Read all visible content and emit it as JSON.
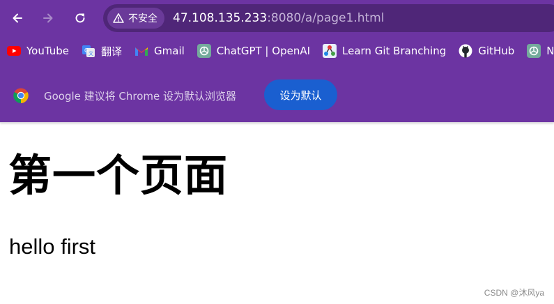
{
  "omnibox": {
    "security_label": "不安全",
    "url_host": "47.108.135.233",
    "url_rest": ":8080/a/page1.html"
  },
  "bookmarks": [
    {
      "label": "YouTube",
      "icon": "youtube-icon"
    },
    {
      "label": "翻译",
      "icon": "translate-icon"
    },
    {
      "label": "Gmail",
      "icon": "gmail-icon"
    },
    {
      "label": "ChatGPT | OpenAI",
      "icon": "openai-icon"
    },
    {
      "label": "Learn Git Branching",
      "icon": "git-branching-icon"
    },
    {
      "label": "GitHub",
      "icon": "github-icon"
    },
    {
      "label": "N",
      "icon": "openai-icon"
    }
  ],
  "infobar": {
    "message": "Google 建议将 Chrome 设为默认浏览器",
    "button_label": "设为默认"
  },
  "page": {
    "heading": "第一个页面",
    "paragraph": "hello first"
  },
  "watermark": "CSDN @沐风ya",
  "colors": {
    "chrome_bg": "#6c34a2",
    "omnibox_bg": "#4f2678",
    "default_button": "#1a5fd0"
  }
}
